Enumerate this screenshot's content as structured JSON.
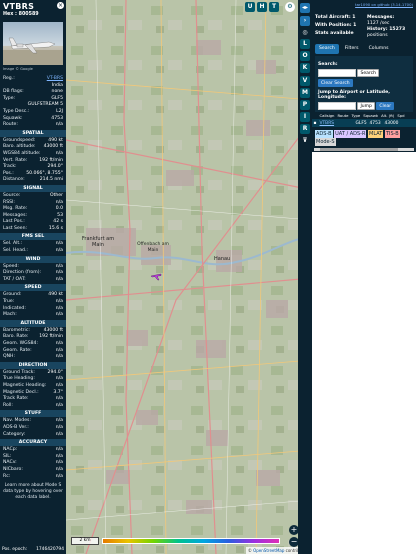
{
  "aircraft": {
    "callsign": "VTBRS",
    "hex_label": "Hex : 800589",
    "photo_credit": "Image © Google",
    "details": [
      {
        "label": "Reg.:",
        "value": "VT-BRS",
        "link": true
      },
      {
        "label": "",
        "value": "India",
        "link": false
      },
      {
        "label": "DB flags:",
        "value": "none",
        "link": false
      },
      {
        "label": "Type:",
        "value": "GLF5",
        "link": false
      },
      {
        "label": "",
        "value": "GULFSTREAM 5",
        "link": false
      },
      {
        "label": "Type Desc.:",
        "value": "L2J",
        "link": false
      },
      {
        "label": "Squawk:",
        "value": "4753",
        "link": false
      },
      {
        "label": "Route:",
        "value": "n/a",
        "link": false
      }
    ]
  },
  "sections": [
    {
      "title": "SPATIAL",
      "rows": [
        {
          "label": "Groundspeed:",
          "value": "490 kt"
        },
        {
          "label": "Baro. altitude:",
          "value": "43000 ft"
        },
        {
          "label": "WGS84 altitude:",
          "value": "n/a"
        },
        {
          "label": "Vert. Rate:",
          "value": "192 ft/min"
        },
        {
          "label": "Track:",
          "value": "294.0°"
        },
        {
          "label": "Pos.:",
          "value": "50.066°, 8.755°"
        },
        {
          "label": "Distance:",
          "value": "214.5 nmi"
        }
      ]
    },
    {
      "title": "SIGNAL",
      "rows": [
        {
          "label": "Source:",
          "value": "Other"
        },
        {
          "label": "RSSI:",
          "value": "n/a"
        },
        {
          "label": "Msg. Rate:",
          "value": "0.0"
        },
        {
          "label": "Messages:",
          "value": "53"
        },
        {
          "label": "Last Pos.:",
          "value": "42 s"
        },
        {
          "label": "Last Seen:",
          "value": "15.6 s"
        }
      ]
    },
    {
      "title": "FMS SEL",
      "rows": [
        {
          "label": "Sel. Alt.:",
          "value": "n/a"
        },
        {
          "label": "Sel. Head.:",
          "value": "n/a"
        }
      ]
    },
    {
      "title": "WIND",
      "rows": [
        {
          "label": "Speed:",
          "value": "n/a"
        },
        {
          "label": "Direction (from):",
          "value": "n/a"
        },
        {
          "label": "TAT / OAT:",
          "value": "n/a"
        }
      ]
    },
    {
      "title": "SPEED",
      "rows": [
        {
          "label": "Ground:",
          "value": "490 kt"
        },
        {
          "label": "True:",
          "value": "n/a"
        },
        {
          "label": "Indicated:",
          "value": "n/a"
        },
        {
          "label": "Mach:",
          "value": "n/a"
        }
      ]
    },
    {
      "title": "ALTITUDE",
      "rows": [
        {
          "label": "Barometric:",
          "value": "43000 ft"
        },
        {
          "label": "Baro. Rate:",
          "value": "192 ft/min"
        },
        {
          "label": "Geom. WGS84:",
          "value": "n/a"
        },
        {
          "label": "Geom. Rate:",
          "value": "n/a"
        },
        {
          "label": "QNH:",
          "value": "n/a"
        }
      ]
    },
    {
      "title": "DIRECTION",
      "rows": [
        {
          "label": "Ground Track:",
          "value": "294.0°"
        },
        {
          "label": "True Heading:",
          "value": "n/a"
        },
        {
          "label": "Magnetic Heading:",
          "value": "n/a"
        },
        {
          "label": "Magnetic Decl.:",
          "value": "3.7°"
        },
        {
          "label": "Track Rate:",
          "value": "n/a"
        },
        {
          "label": "Roll:",
          "value": "n/a"
        }
      ]
    },
    {
      "title": "STUFF",
      "rows": [
        {
          "label": "Nav. Modes:",
          "value": "n/a"
        },
        {
          "label": "ADS-B Ver.:",
          "value": "n/a"
        },
        {
          "label": "Category:",
          "value": "n/a"
        }
      ]
    },
    {
      "title": "ACCURACY",
      "rows": [
        {
          "label": "NACp:",
          "value": "n/a"
        },
        {
          "label": "SIL:",
          "value": "n/a"
        },
        {
          "label": "NACv:",
          "value": "n/a"
        },
        {
          "label": "NICbaro:",
          "value": "n/a"
        },
        {
          "label": "Rc:",
          "value": "n/a"
        }
      ]
    }
  ],
  "note": "Learn more about Mode S data type by hovering over each data label.",
  "epoch": {
    "label": "Pos. epoch:",
    "value": "1746420794"
  },
  "map": {
    "labels": [
      "Frankfurt am Main",
      "Offenbach am Main",
      "Hanau"
    ],
    "buttons": [
      "U",
      "H",
      "T"
    ],
    "left_buttons": [
      "L",
      "O",
      "K",
      "V",
      "M",
      "P",
      "I",
      "R"
    ],
    "zoom_in": "+",
    "zoom_out": "−",
    "scale": "2 km",
    "attribution_prefix": "© ",
    "attribution_link": "OpenStreetMap",
    "attribution_suffix": " contributors",
    "aircraft_color": "#c03de0"
  },
  "sidebar": {
    "link": "tar1090 on github (3.14.1700)",
    "total_label": "Total Aircraft: 1",
    "with_position": "With Position: 1",
    "stats_available": "Stats available",
    "messages_label": "Messages:",
    "messages_value": "1127 /sec",
    "history_label": "History: 15273",
    "history_sub": "positions",
    "tabs": [
      "Search",
      "Filters",
      "Columns"
    ],
    "search_label": "Search:",
    "search_button": "Search",
    "clear_search": "Clear Search",
    "jump_label": "Jump to Airport or Latitude, Longitude:",
    "jump_button": "Jump",
    "clear_button": "Clear",
    "columns": [
      "Callsign",
      "Route",
      "Type",
      "Squawk",
      "Alt. (ft)",
      "Spd"
    ],
    "row": {
      "callsign": "VTBRS",
      "type": "GLF5",
      "squawk": "4753",
      "alt": "43000"
    },
    "badges": [
      "ADS-B",
      "UAT / ADS-R",
      "MLAT",
      "TIS-B",
      "Mode-S",
      "AIS"
    ]
  }
}
